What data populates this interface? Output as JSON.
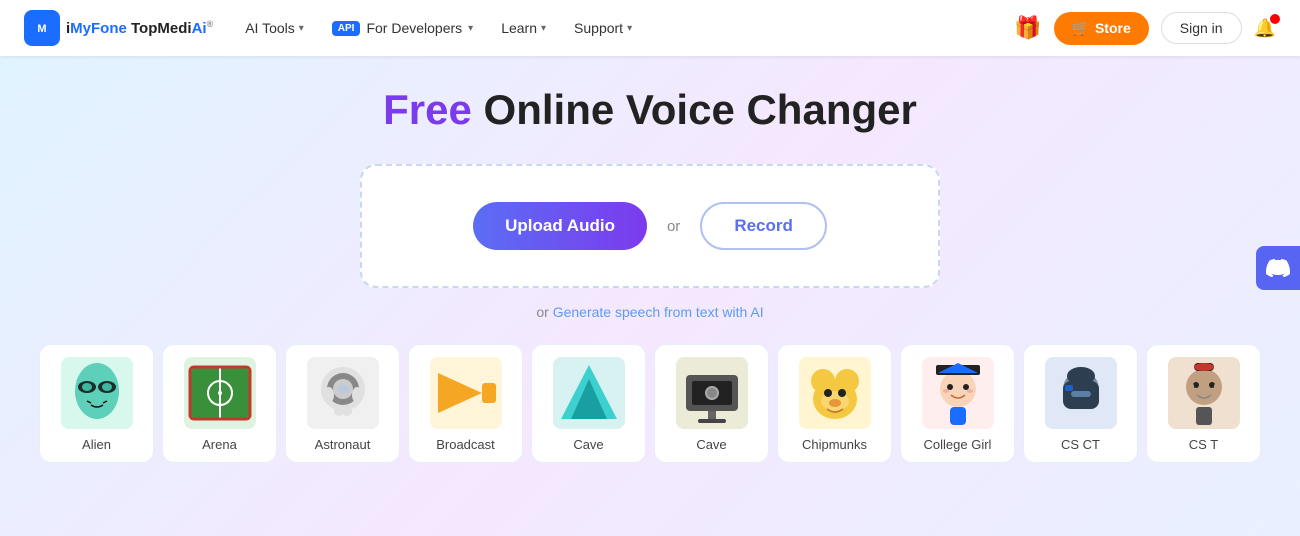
{
  "navbar": {
    "logo_brand": "iMyFone",
    "logo_product": "TopMediAi",
    "logo_symbol": "M",
    "nav_items": [
      {
        "label": "AI Tools",
        "has_chevron": true,
        "id": "ai-tools"
      },
      {
        "label": "For Developers",
        "has_chevron": true,
        "id": "for-developers",
        "badge": "API"
      },
      {
        "label": "Learn",
        "has_chevron": true,
        "id": "learn"
      },
      {
        "label": "Support",
        "has_chevron": true,
        "id": "support"
      }
    ],
    "store_label": "Store",
    "signin_label": "Sign in"
  },
  "hero": {
    "title_free": "Free",
    "title_rest": " Online Voice Changer",
    "upload_label": "Upload Audio",
    "or_text": "or",
    "record_label": "Record",
    "generate_prefix": "or ",
    "generate_link_text": "Generate speech from text with AI"
  },
  "voice_cards": [
    {
      "id": "alien",
      "label": "Alien",
      "emoji": "👽",
      "bg": "#e0f8f0"
    },
    {
      "id": "arena",
      "label": "Arena",
      "emoji": "🏟️",
      "bg": "#e8f5e8"
    },
    {
      "id": "astronaut",
      "label": "Astronaut",
      "emoji": "🤖",
      "bg": "#f0f0f0"
    },
    {
      "id": "broadcast",
      "label": "Broadcast",
      "emoji": "📢",
      "bg": "#fff5e0"
    },
    {
      "id": "cave1",
      "label": "Cave",
      "emoji": "🏔️",
      "bg": "#e0f5f5"
    },
    {
      "id": "cave2",
      "label": "Cave",
      "emoji": "🎥",
      "bg": "#f0f0e8"
    },
    {
      "id": "chipmunks",
      "label": "Chipmunks",
      "emoji": "🐿️",
      "bg": "#fff5e0"
    },
    {
      "id": "college-girl",
      "label": "College Girl",
      "emoji": "👩‍🎓",
      "bg": "#fff0f0"
    },
    {
      "id": "csct",
      "label": "CS CT",
      "emoji": "🥷",
      "bg": "#e8eef8"
    },
    {
      "id": "cst",
      "label": "CS T",
      "emoji": "🧔",
      "bg": "#f5e8e0"
    }
  ],
  "discord": {
    "icon": "💬"
  }
}
